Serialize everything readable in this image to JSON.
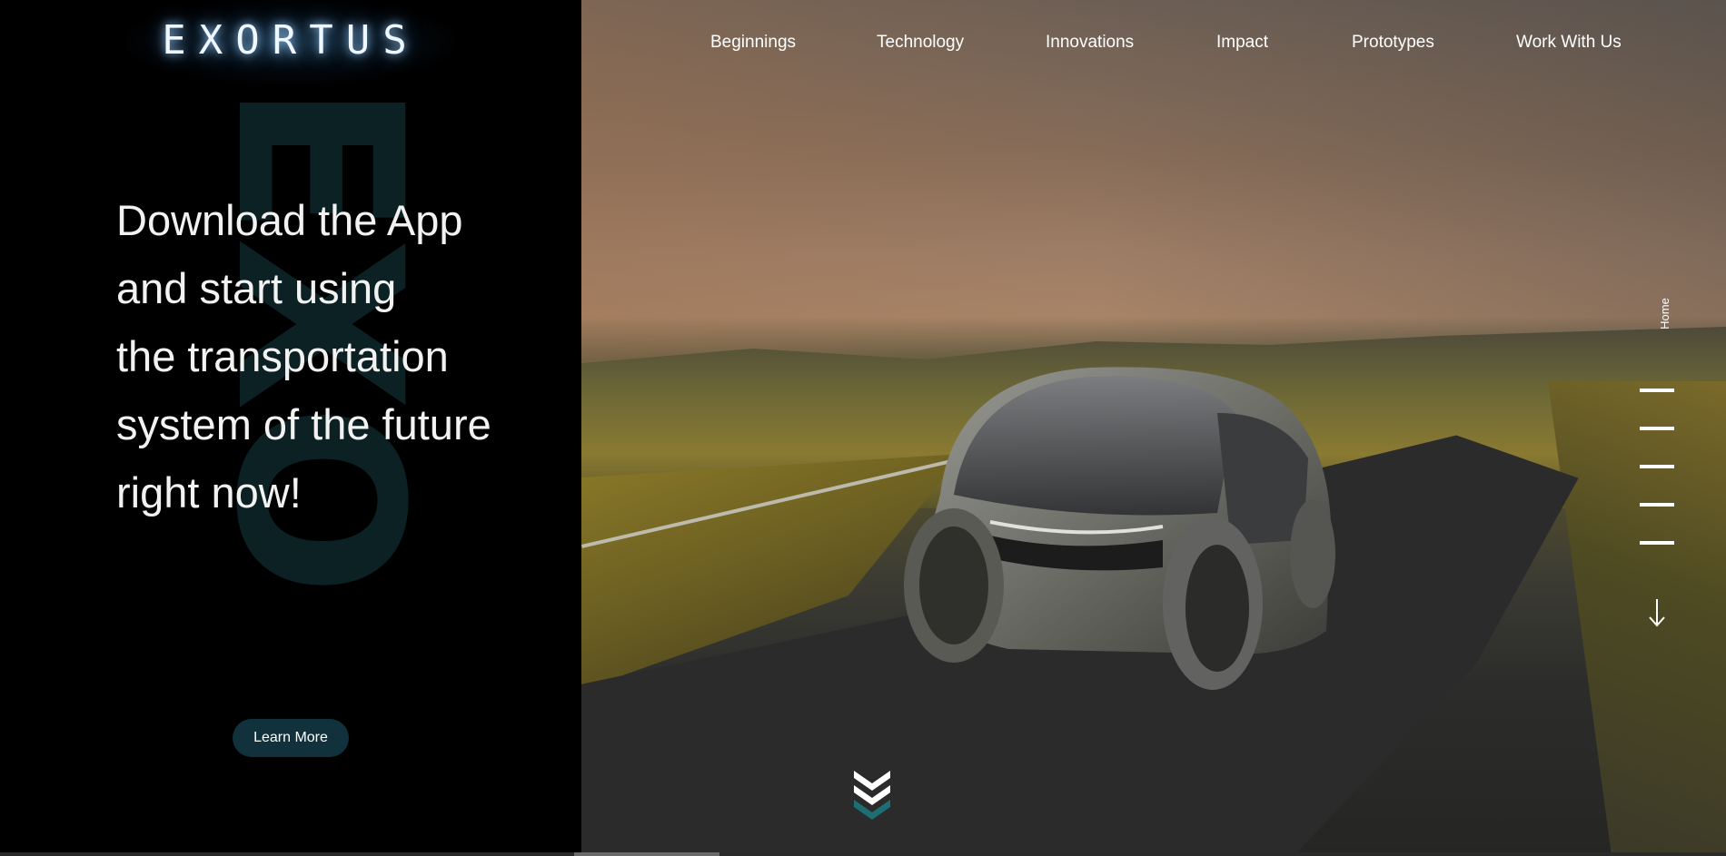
{
  "brand": {
    "logo_text": "EXORTUS",
    "watermark_text": "EXO"
  },
  "nav": {
    "items": [
      "Beginnings",
      "Technology",
      "Innovations",
      "Impact",
      "Prototypes",
      "Work With Us"
    ]
  },
  "hero": {
    "headline_lines": [
      "Download the App",
      "and start using",
      "the transportation",
      "system of the future",
      "right now!"
    ],
    "cta_label": "Learn More"
  },
  "side_nav": {
    "current_section": "Home",
    "section_count": 5
  },
  "icons": {
    "scroll_down": "arrow-down-icon",
    "chevrons": "double-chevron-down-icon"
  },
  "colors": {
    "accent": "#11323d",
    "accent_teal": "#1e6f73",
    "watermark": "#0f2a2d",
    "text": "#ffffff"
  }
}
